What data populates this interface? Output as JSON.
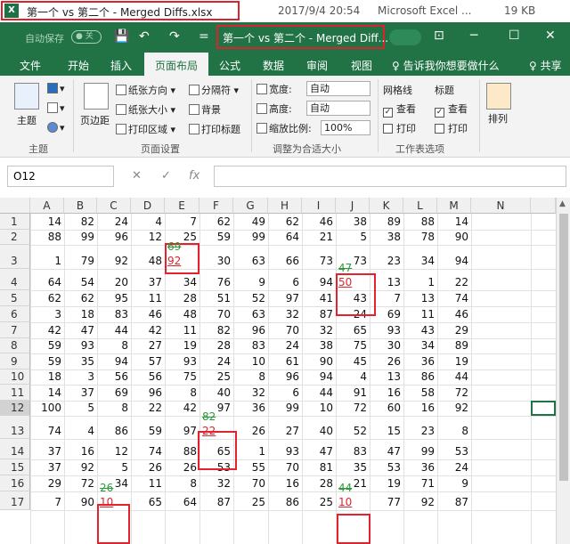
{
  "filebar": {
    "filename": "第一个 vs 第二个 - Merged Diffs.xlsx",
    "date": "2017/9/4 20:54",
    "type": "Microsoft Excel ...",
    "size": "19 KB"
  },
  "titlebar": {
    "autosave": "自动保存",
    "toggle": "● 关",
    "title": "第一个 vs 第二个 - Merged Diff...",
    "qat": [
      "💾",
      "↶",
      "↷",
      "="
    ],
    "winbtns": [
      "⊡",
      "─",
      "☐",
      "✕"
    ]
  },
  "tabs": [
    "文件",
    "开始",
    "插入",
    "页面布局",
    "公式",
    "数据",
    "审阅",
    "视图",
    "♀ 告诉我你想要做什么",
    "♀ 共享"
  ],
  "ribbon": {
    "theme": "主题",
    "themes_group": "主题",
    "margins": "页边距",
    "orientation": "纸张方向",
    "size": "纸张大小",
    "print_area": "打印区域",
    "breaks": "分隔符",
    "background": "背景",
    "print_titles": "打印标题",
    "page_setup": "页面设置",
    "width_label": "宽度:",
    "width_val": "自动",
    "height_label": "高度:",
    "height_val": "自动",
    "scale_label": "缩放比例:",
    "scale_val": "100%",
    "scale_group": "调整为合适大小",
    "gridlines": "网格线",
    "headings": "标题",
    "view": "查看",
    "print": "打印",
    "sheet_options": "工作表选项",
    "arrange": "排列"
  },
  "formula_bar": {
    "name_box": "O12",
    "cancel": "✕",
    "enter": "✓",
    "fx": "fx"
  },
  "sheet": {
    "columns": [
      "A",
      "B",
      "C",
      "D",
      "E",
      "F",
      "G",
      "H",
      "I",
      "J",
      "K",
      "L",
      "M",
      "N"
    ],
    "rows": [
      {
        "n": "1",
        "v": [
          "14",
          "82",
          "24",
          "4",
          "7",
          "62",
          "49",
          "62",
          "46",
          "38",
          "89",
          "88",
          "14"
        ]
      },
      {
        "n": "2",
        "v": [
          "88",
          "99",
          "96",
          "12",
          "25",
          "59",
          "99",
          "64",
          "21",
          "5",
          "38",
          "78",
          "90"
        ]
      },
      {
        "n": "3",
        "v": [
          "1",
          "79",
          "92",
          "48",
          "",
          "30",
          "63",
          "66",
          "73",
          "73",
          "23",
          "34",
          "94"
        ]
      },
      {
        "n": "4",
        "v": [
          "64",
          "54",
          "20",
          "37",
          "34",
          "76",
          "9",
          "6",
          "94",
          "",
          "13",
          "1",
          "22"
        ]
      },
      {
        "n": "5",
        "v": [
          "62",
          "62",
          "95",
          "11",
          "28",
          "51",
          "52",
          "97",
          "41",
          "43",
          "7",
          "13",
          "74"
        ]
      },
      {
        "n": "6",
        "v": [
          "3",
          "18",
          "83",
          "46",
          "48",
          "70",
          "63",
          "32",
          "87",
          "24",
          "69",
          "11",
          "46"
        ]
      },
      {
        "n": "7",
        "v": [
          "42",
          "47",
          "44",
          "42",
          "11",
          "82",
          "96",
          "70",
          "32",
          "65",
          "93",
          "43",
          "29"
        ]
      },
      {
        "n": "8",
        "v": [
          "59",
          "93",
          "8",
          "27",
          "19",
          "28",
          "83",
          "24",
          "38",
          "75",
          "30",
          "34",
          "89"
        ]
      },
      {
        "n": "9",
        "v": [
          "59",
          "35",
          "94",
          "57",
          "93",
          "24",
          "10",
          "61",
          "90",
          "45",
          "26",
          "36",
          "19"
        ]
      },
      {
        "n": "10",
        "v": [
          "18",
          "3",
          "56",
          "56",
          "75",
          "25",
          "8",
          "96",
          "94",
          "4",
          "13",
          "86",
          "44"
        ]
      },
      {
        "n": "11",
        "v": [
          "14",
          "37",
          "69",
          "96",
          "8",
          "40",
          "32",
          "6",
          "44",
          "91",
          "16",
          "58",
          "72"
        ]
      },
      {
        "n": "12",
        "v": [
          "100",
          "5",
          "8",
          "22",
          "42",
          "97",
          "36",
          "99",
          "10",
          "72",
          "60",
          "16",
          "92"
        ]
      },
      {
        "n": "13",
        "v": [
          "74",
          "4",
          "86",
          "59",
          "97",
          "",
          "26",
          "27",
          "40",
          "52",
          "15",
          "23",
          "8"
        ]
      },
      {
        "n": "14",
        "v": [
          "37",
          "16",
          "12",
          "74",
          "88",
          "65",
          "1",
          "93",
          "47",
          "83",
          "47",
          "99",
          "53"
        ]
      },
      {
        "n": "15",
        "v": [
          "37",
          "92",
          "5",
          "26",
          "26",
          "53",
          "55",
          "70",
          "81",
          "35",
          "53",
          "36",
          "24"
        ]
      },
      {
        "n": "16",
        "v": [
          "29",
          "72",
          "34",
          "11",
          "8",
          "32",
          "70",
          "16",
          "28",
          "21",
          "19",
          "71",
          "9"
        ]
      },
      {
        "n": "17",
        "v": [
          "7",
          "90",
          "",
          "65",
          "64",
          "87",
          "25",
          "86",
          "25",
          "",
          "77",
          "92",
          "87"
        ]
      }
    ],
    "diffs": [
      {
        "old": "69",
        "new": "92"
      },
      {
        "old": "47",
        "new": "50"
      },
      {
        "old": "82",
        "new": "22"
      },
      {
        "old": "26",
        "new": "10"
      },
      {
        "old": "44",
        "new": "10"
      }
    ]
  }
}
